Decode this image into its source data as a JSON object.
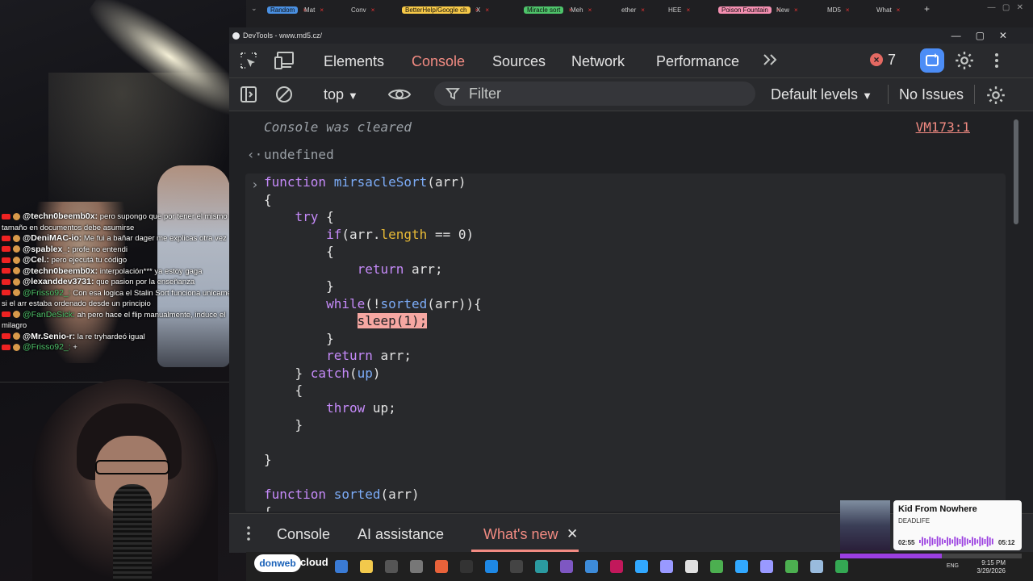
{
  "browser_tabs": [
    {
      "label": "Random",
      "color": "#4a90e2"
    },
    {
      "label": "Mat",
      "color": ""
    },
    {
      "label": "Conv",
      "color": ""
    },
    {
      "label": "BetterHelp/Google ch",
      "color": "#f7c948"
    },
    {
      "label": "X",
      "color": ""
    },
    {
      "label": "Miracle sort",
      "color": "#4ec36a"
    },
    {
      "label": "Meh",
      "color": ""
    },
    {
      "label": "ether",
      "color": ""
    },
    {
      "label": "HEE",
      "color": ""
    },
    {
      "label": "Poison Fountain",
      "color": "#f48fb1"
    },
    {
      "label": "New",
      "color": ""
    },
    {
      "label": "MD5",
      "color": ""
    },
    {
      "label": "What",
      "color": ""
    }
  ],
  "devtools": {
    "window_title": "DevTools - www.md5.cz/",
    "tabs": [
      "Elements",
      "Console",
      "Sources",
      "Network",
      "Performance"
    ],
    "active_tab": "Console",
    "error_count": "7",
    "toolbar": {
      "context": "top",
      "filter_placeholder": "Filter",
      "levels": "Default levels",
      "issues": "No Issues"
    },
    "console": {
      "cleared_msg": "Console was cleared",
      "vm_link": "VM173:1",
      "undefined_text": "undefined",
      "code_lines": [
        "function mirsacleSort(arr)",
        "{",
        "    try {",
        "        if(arr.length == 0)",
        "        {",
        "            return arr;",
        "        }",
        "        while(!sorted(arr)){",
        "            sleep(1);",
        "        }",
        "        return arr;",
        "    } catch(up)",
        "    {",
        "        throw up;",
        "    }",
        "",
        "}",
        "",
        "function sorted(arr)",
        "{"
      ]
    },
    "drawer": {
      "tabs": [
        "Console",
        "AI assistance",
        "What's new"
      ],
      "active_tab": "What's new"
    }
  },
  "chat": [
    {
      "user": "@techn0beemb0x:",
      "msg": "pero supongo que por tener el mismo tamaño en documentos debe asumirse",
      "green": false
    },
    {
      "user": "@DeniMAC-io:",
      "msg": "Me fui a bañar dager me explicas otra vez",
      "green": false
    },
    {
      "user": "@spablex_:",
      "msg": "profe no entendi",
      "green": false
    },
    {
      "user": "@Cel.:",
      "msg": "pero ejecutá tu código",
      "green": false
    },
    {
      "user": "@techn0beemb0x:",
      "msg": "interpolación*** ya estoy gaga",
      "green": false
    },
    {
      "user": "@lexanddev3731:",
      "msg": "que pasion por la enseñanza",
      "green": false
    },
    {
      "user": "@Frisso92_:",
      "msg": "Con esa logica el Stalin Sort funciona unicamente si el arr estaba ordenado desde un principio",
      "green": true
    },
    {
      "user": "@FanDeSick:",
      "msg": "ah pero hace el flip manualmente, induce el milagro",
      "green": true
    },
    {
      "user": "@Mr.Senio-r:",
      "msg": "la re tryhardeó igual",
      "green": false
    },
    {
      "user": "@Frisso92_:",
      "msg": "+",
      "green": true
    }
  ],
  "logo": {
    "brand": "donweb",
    "suffix": "cloud"
  },
  "music": {
    "title": "Kid From Nowhere",
    "artist": "DEADLIFE",
    "time_current": "02:55",
    "time_total": "05:12",
    "progress": 0.56
  },
  "taskbar": {
    "lang": "ENG",
    "time": "9:15 PM",
    "date": "3/29/2026"
  },
  "colors": {
    "accent_console": "#f28b82",
    "keyword": "#c58af9",
    "function_name": "#7cacf8",
    "property": "#e8ba36",
    "highlight": "#f6a7a2"
  }
}
